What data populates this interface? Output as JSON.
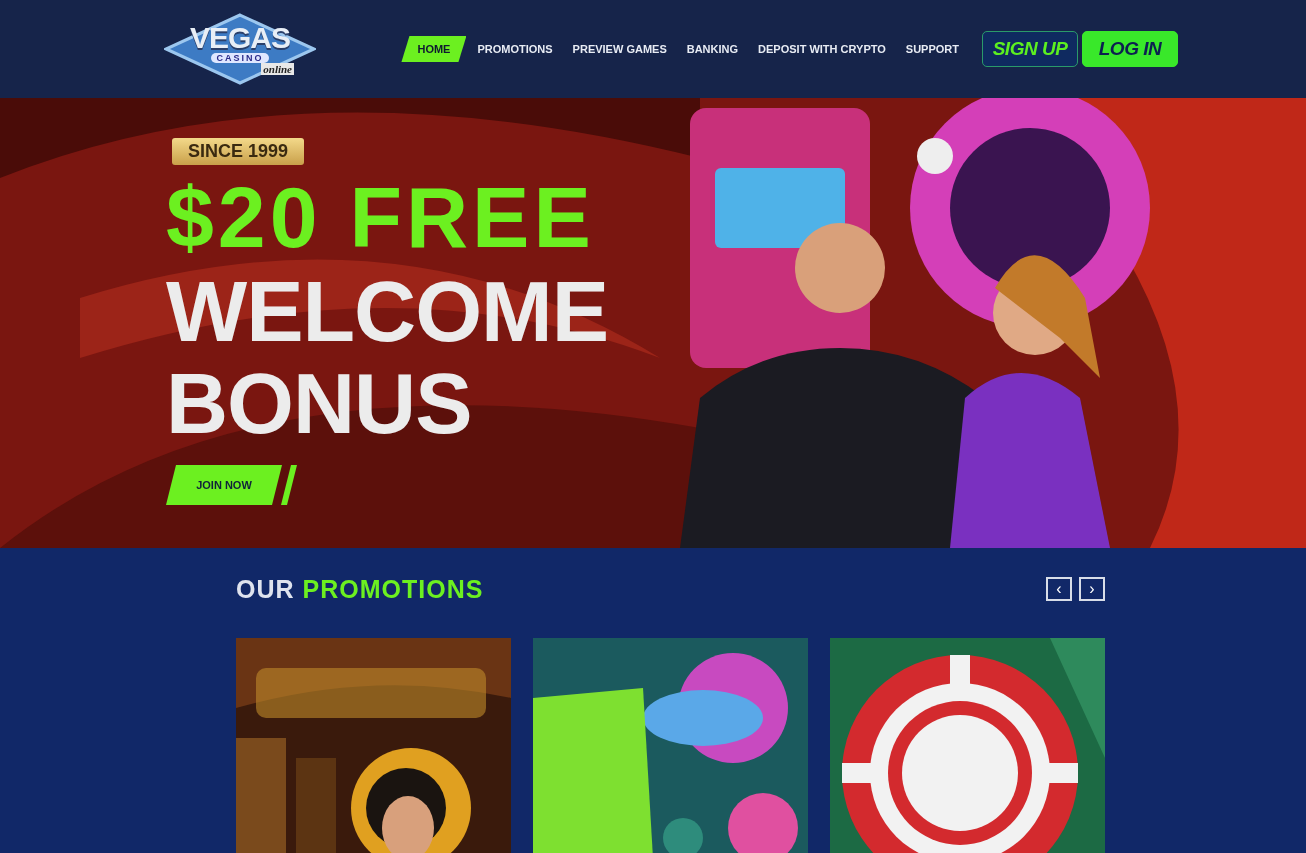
{
  "logo": {
    "main": "VEGAS",
    "sub": "CASINO",
    "tag": "online"
  },
  "nav": [
    {
      "label": "HOME",
      "selected": true
    },
    {
      "label": "PROMOTIONS",
      "selected": false
    },
    {
      "label": "PREVIEW GAMES",
      "selected": false
    },
    {
      "label": "BANKING",
      "selected": false
    },
    {
      "label": "DEPOSIT WITH CRYPTO",
      "selected": false
    },
    {
      "label": "SUPPORT",
      "selected": false
    }
  ],
  "auth_buttons": [
    {
      "label": "SIGN UP",
      "kind": "outline"
    },
    {
      "label": "LOG IN",
      "kind": "solid"
    }
  ],
  "hero": {
    "badge": "SINCE 1999",
    "headline": "$20 FREE",
    "subline": [
      "WELCOME",
      "BONUS"
    ],
    "cta": "JOIN NOW"
  },
  "promotions": {
    "title": [
      {
        "text": "OUR",
        "accent": false
      },
      {
        "text": "PROMOTIONS",
        "accent": true
      }
    ],
    "prev": "‹",
    "next": "›"
  }
}
